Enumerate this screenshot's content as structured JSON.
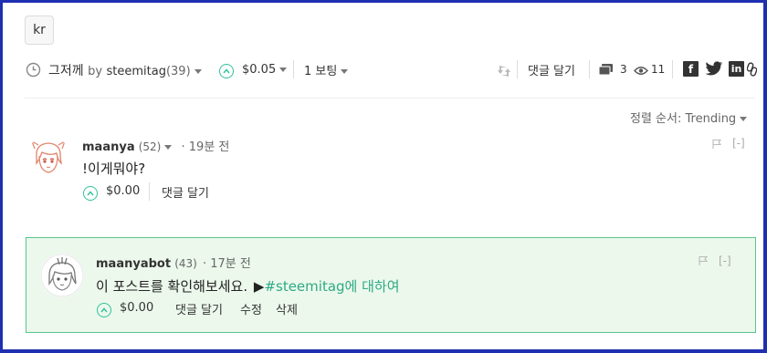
{
  "post": {
    "tag": "kr",
    "time_label": "그저께",
    "by_label": "by",
    "author": "steemitag",
    "author_rep": "(39)",
    "payout": "$0.05",
    "votes": "1 보팅",
    "reply_label": "댓글 달기",
    "comment_count": "3",
    "view_count": "11"
  },
  "sort": {
    "label": "정렬 순서:",
    "value": "Trending"
  },
  "comments": [
    {
      "author": "maanya",
      "rep": "(52)",
      "time": "· 19분 전",
      "body": "!이게뭐야?",
      "payout": "$0.00",
      "reply_label": "댓글 달기",
      "collapse": "[-]"
    },
    {
      "author": "maanyabot",
      "rep": "(43)",
      "time": "· 17분 전",
      "body": "이 포스트를 확인해보세요.",
      "arrow": "▶",
      "link": "#steemitag에 대하여",
      "payout": "$0.00",
      "reply_label": "댓글 달기",
      "edit_label": "수정",
      "delete_label": "삭제",
      "collapse": "[-]"
    }
  ],
  "colors": {
    "accent": "#2eaa85",
    "highlight_bg": "#ecf8ec",
    "highlight_border": "#58c58c",
    "frame_border": "#1e2fb0"
  },
  "icons": [
    "clock-icon",
    "upvote-icon",
    "resteem-icon",
    "comments-icon",
    "eye-icon",
    "facebook-icon",
    "twitter-icon",
    "linkedin-icon",
    "link-icon",
    "flag-icon"
  ]
}
